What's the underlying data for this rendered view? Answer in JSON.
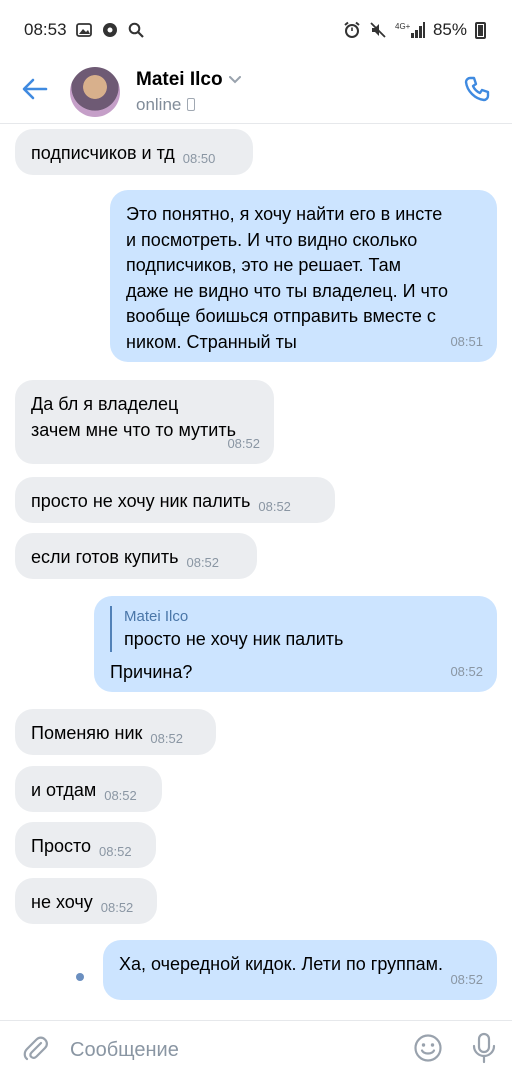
{
  "status_bar": {
    "time": "08:53",
    "battery": "85%",
    "network": "4G+"
  },
  "header": {
    "contact_name": "Matei Ilco",
    "status": "online",
    "accent_color": "#3f8ae0"
  },
  "messages": [
    {
      "direction": "in",
      "text": "подписчиков и тд",
      "time": "08:50"
    },
    {
      "direction": "out",
      "text": "Это понятно, я хочу найти его в инсте\nи посмотреть. И что видно сколько\nподписчиков, это не решает. Там\nдаже не видно что ты владелец. И что\nвообще боишься отправить вместе с\nником. Странный ты",
      "time": "08:51"
    },
    {
      "direction": "in",
      "text": "Да бл я владелец\nзачем мне что то мутить",
      "time": "08:52"
    },
    {
      "direction": "in",
      "text": "просто не хочу ник палить",
      "time": "08:52"
    },
    {
      "direction": "in",
      "text": "если готов купить",
      "time": "08:52"
    },
    {
      "direction": "out",
      "reply_author": "Matei Ilco",
      "reply_text": "просто не хочу ник палить",
      "text": "Причина?",
      "time": "08:52"
    },
    {
      "direction": "in",
      "text": "Поменяю ник",
      "time": "08:52"
    },
    {
      "direction": "in",
      "text": "и отдам",
      "time": "08:52"
    },
    {
      "direction": "in",
      "text": "Просто",
      "time": "08:52"
    },
    {
      "direction": "in",
      "text": "не хочу",
      "time": "08:52"
    },
    {
      "direction": "out",
      "text": "Ха, очередной кидок. Лети по группам.",
      "time": "08:52"
    }
  ],
  "composer": {
    "placeholder": "Сообщение"
  },
  "icons": {
    "back": "arrow-left-icon",
    "call": "phone-icon",
    "attach": "paperclip-icon",
    "emoji": "smile-icon",
    "mic": "microphone-icon"
  },
  "colors": {
    "incoming_bubble": "#ebedf0",
    "outgoing_bubble": "#cce4ff",
    "accent": "#3f8ae0",
    "secondary_text": "#818c99"
  }
}
